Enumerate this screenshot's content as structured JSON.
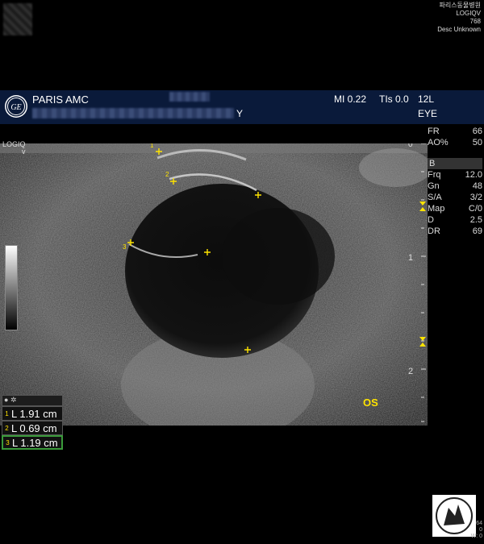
{
  "corner": {
    "hospital": "파리스동물병원",
    "system": "LOGIQV",
    "code": "768",
    "desc": "Desc Unknown"
  },
  "header": {
    "institution": "PARIS AMC",
    "info_tail": "Y",
    "mi": "MI 0.22",
    "tis": "TIs 0.0",
    "probe": "12L",
    "preset": "EYE"
  },
  "params": {
    "top": [
      {
        "key": "FR",
        "val": "66"
      },
      {
        "key": "AO%",
        "val": "50"
      }
    ],
    "mode": "B",
    "bmode": [
      {
        "key": "Frq",
        "val": "12.0"
      },
      {
        "key": "Gn",
        "val": "48"
      },
      {
        "key": "S/A",
        "val": "3/2"
      },
      {
        "key": "Map",
        "val": "C/0"
      },
      {
        "key": "D",
        "val": "2.5"
      },
      {
        "key": "DR",
        "val": "69"
      }
    ]
  },
  "logiq_label": "LOGIQ",
  "depth_marks": [
    "0",
    "1",
    "2"
  ],
  "laterality": "OS",
  "caliper_labels": [
    "1",
    "2",
    "3"
  ],
  "measurements": [
    {
      "index": "1",
      "text": "L 1.91 cm"
    },
    {
      "index": "2",
      "text": "L 0.69 cm"
    },
    {
      "index": "3",
      "text": "L 1.19 cm"
    }
  ],
  "bottom_right": {
    "line1": "64",
    "line2": "0",
    "line3": "W: 0"
  },
  "colors": {
    "caliper": "#ffe400",
    "header_bg": "#0a1a3a",
    "selected": "#3a9a3a"
  }
}
